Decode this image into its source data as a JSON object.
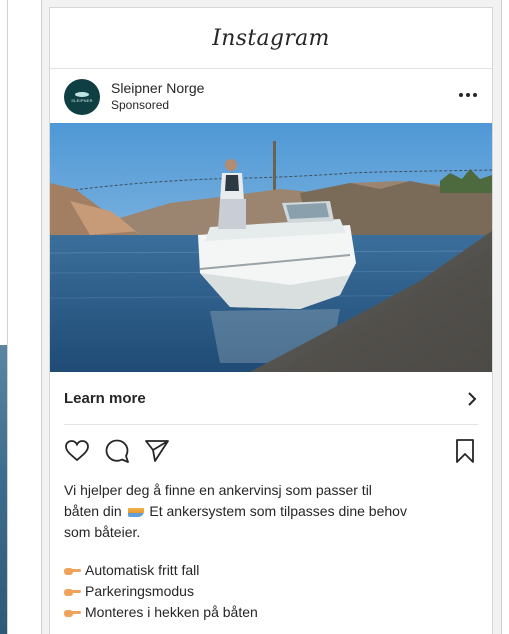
{
  "ig_header": {
    "logo_text": "Instagram"
  },
  "post": {
    "avatar_text": "SLEIPNER",
    "account_name": "Sleipner Norge",
    "account_subtitle": "Sponsored",
    "more_icon": "more-horizontal-icon",
    "photo_description_icon": "boat-photo"
  },
  "cta": {
    "label": "Learn more",
    "icon": "chevron-right-icon"
  },
  "actions": {
    "like_icon": "heart-icon",
    "comment_icon": "comment-icon",
    "share_icon": "send-icon",
    "save_icon": "bookmark-icon"
  },
  "caption": {
    "line1": "Vi hjelper deg å finne en ankervinsj som passer til",
    "line2_a": "båten din",
    "line2_b": "Et ankersystem som tilpasses dine behov",
    "line3": "som båteier."
  },
  "bullets": [
    {
      "text": "Automatisk fritt fall"
    },
    {
      "text": "Parkeringsmodus"
    },
    {
      "text": "Monteres i hekken på båten"
    }
  ],
  "colors": {
    "text": "#262626",
    "avatar": "#0f3f43",
    "sky": "#5aa0d8",
    "sea": "#2f5f8d"
  }
}
